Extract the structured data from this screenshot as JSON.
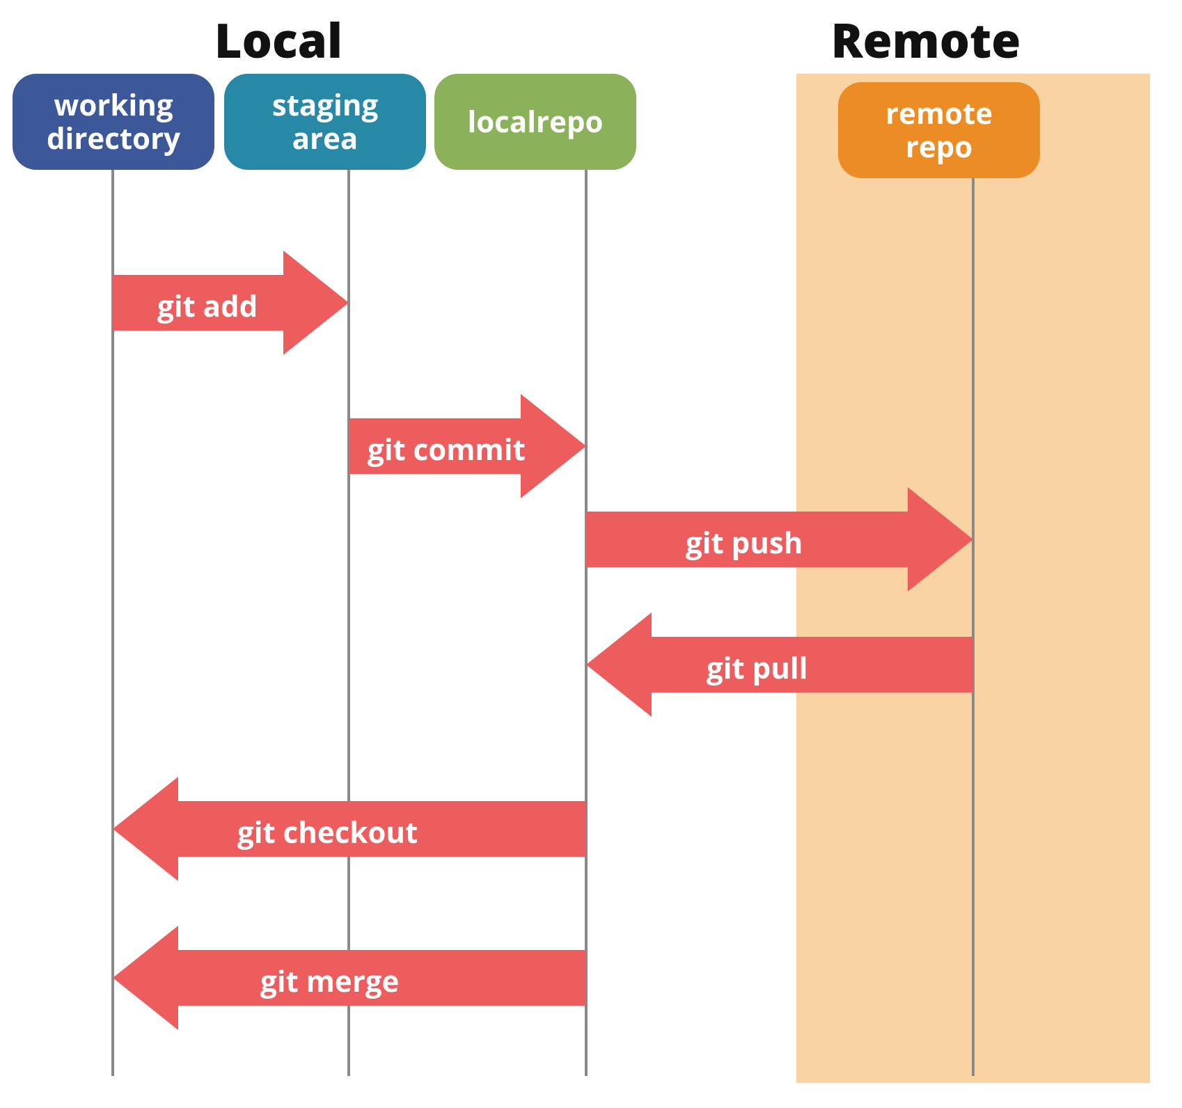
{
  "sections": {
    "local": "Local",
    "remote": "Remote"
  },
  "nodes": {
    "working_directory": "working\ndirectory",
    "staging_area": "staging\narea",
    "local_repo": "localrepo",
    "remote_repo": "remote\nrepo"
  },
  "arrows": {
    "add": "git add",
    "commit": "git commit",
    "push": "git push",
    "pull": "git pull",
    "checkout": "git checkout",
    "merge": "git merge"
  },
  "colors": {
    "node_wd": "#3c5899",
    "node_stage": "#2889a7",
    "node_local": "#8bb15b",
    "node_remote": "#ec8c24",
    "remote_bg": "#f9d3a3",
    "arrow": "#ed5d5d",
    "lifeline": "#8a8a8a"
  }
}
